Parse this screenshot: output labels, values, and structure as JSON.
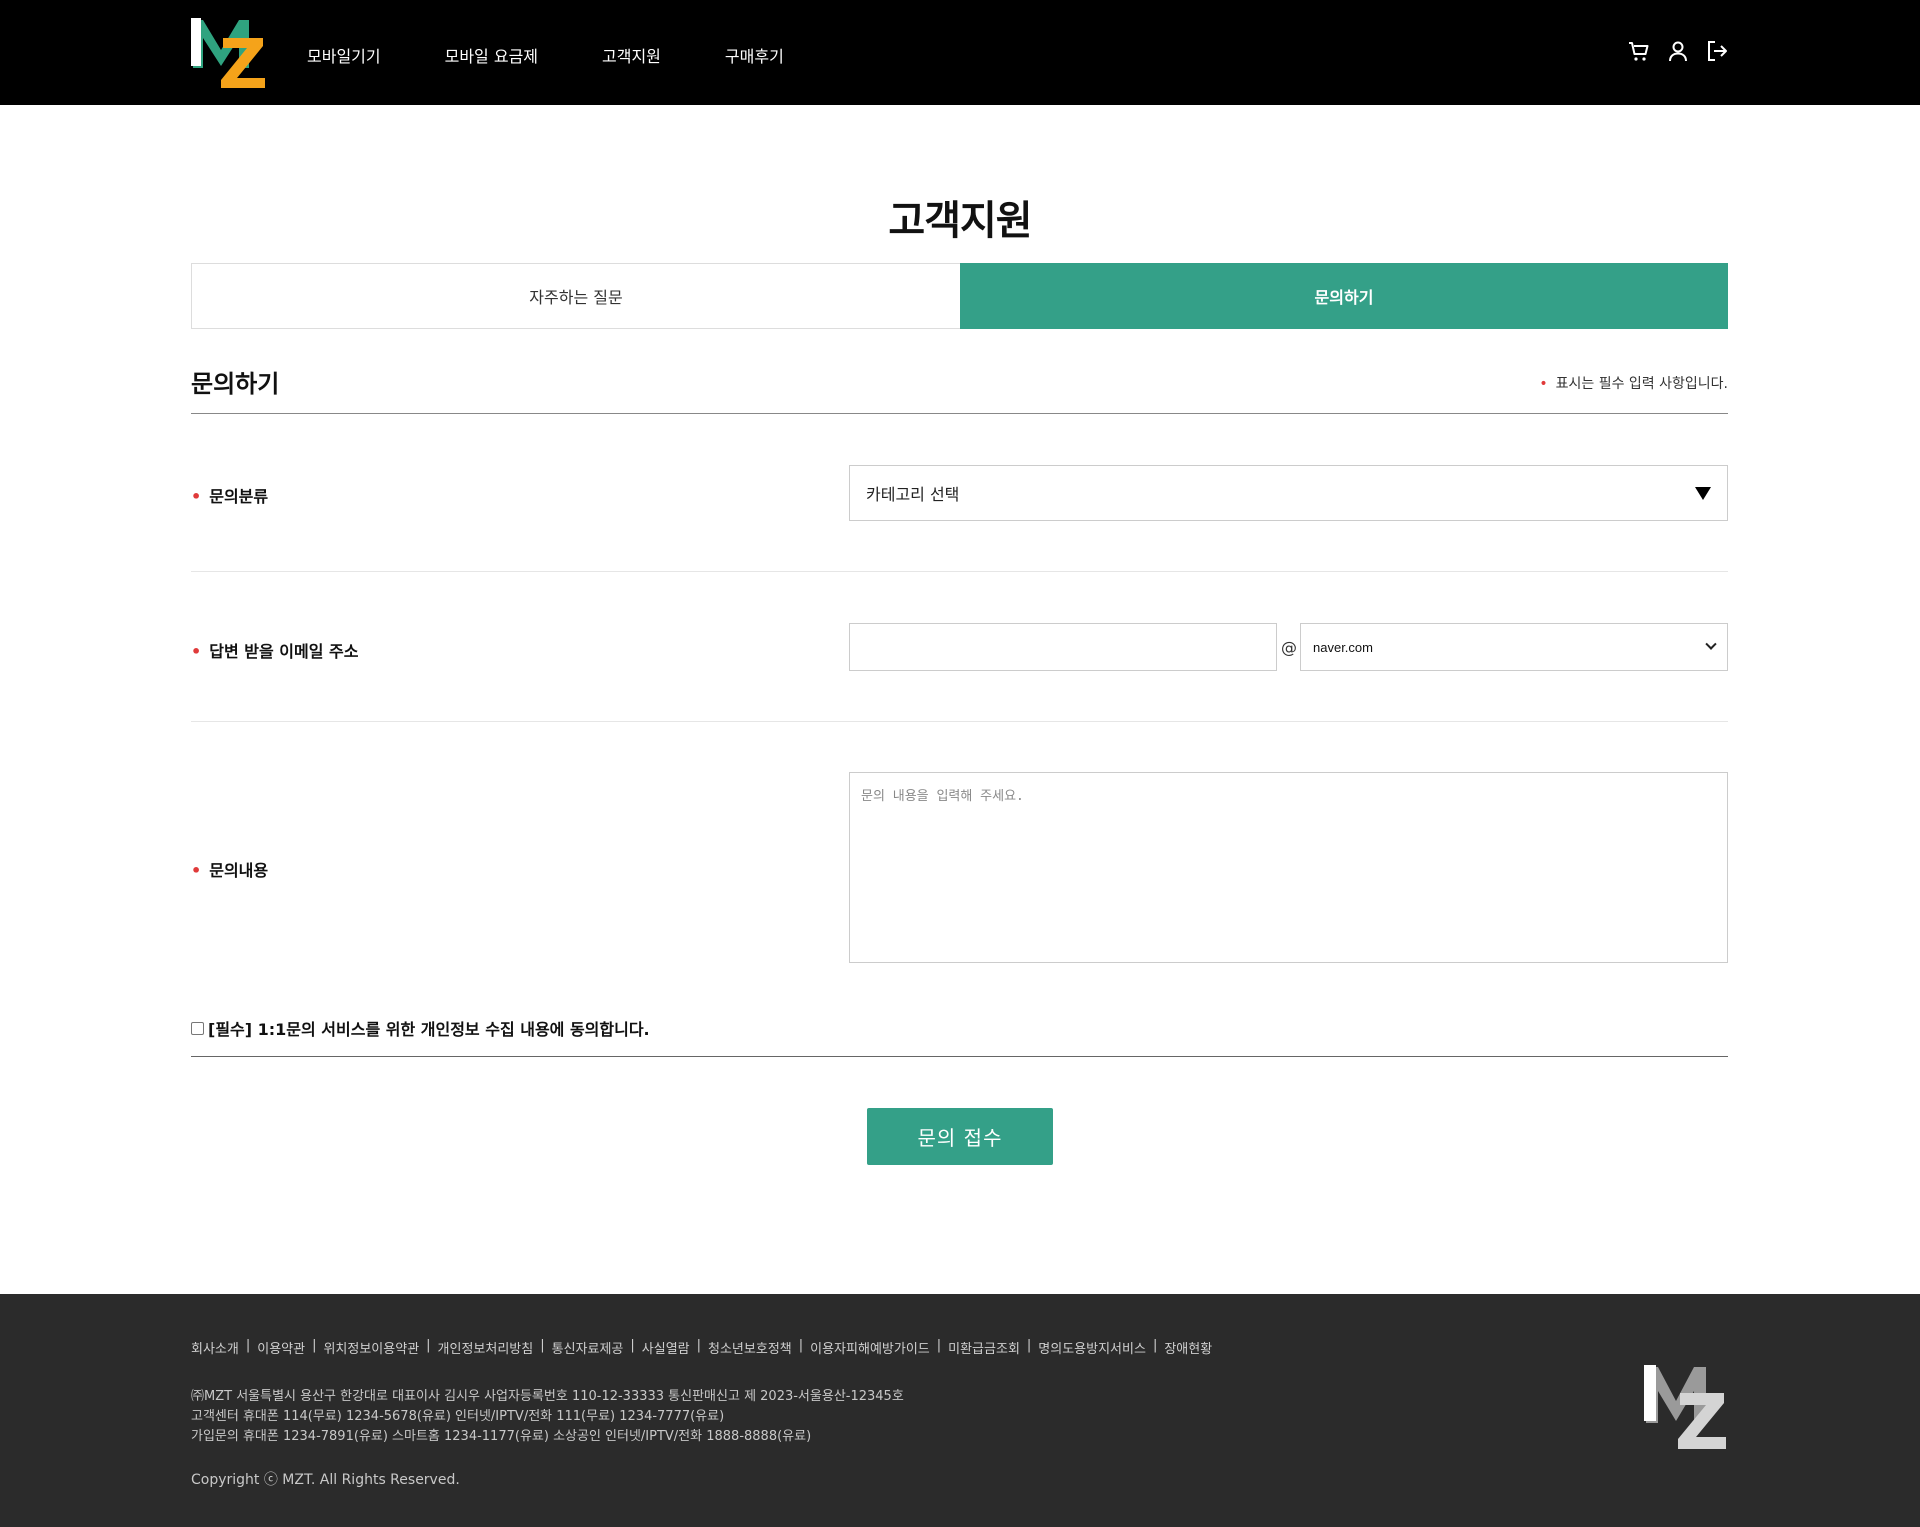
{
  "header": {
    "logo_text": "MZ",
    "nav": [
      "모바일기기",
      "모바일 요금제",
      "고객지원",
      "구매후기"
    ],
    "icons": [
      "cart-icon",
      "user-icon",
      "logout-icon"
    ]
  },
  "page": {
    "title": "고객지원",
    "tabs": [
      {
        "label": "자주하는 질문",
        "active": false
      },
      {
        "label": "문의하기",
        "active": true
      }
    ],
    "section_title": "문의하기",
    "required_note": "표시는 필수 입력 사항입니다."
  },
  "form": {
    "category": {
      "label": "문의분류",
      "selected": "카테고리 선택"
    },
    "email": {
      "label": "답변 받을 이메일 주소",
      "value": "",
      "at": "@",
      "domain_selected": "naver.com"
    },
    "content": {
      "label": "문의내용",
      "placeholder": "문의 내용을 입력해 주세요."
    },
    "consent_label": "[필수] 1:1문의 서비스를 위한 개인정보 수집 내용에 동의합니다.",
    "consent_checked": false,
    "submit_label": "문의 접수"
  },
  "footer": {
    "links": [
      "회사소개",
      "이용약관",
      "위치정보이용약관",
      "개인정보처리방침",
      "통신자료제공",
      "사실열람",
      "청소년보호정책",
      "이용자피해예방가이드",
      "미환급금조회",
      "명의도용방지서비스",
      "장애현황"
    ],
    "info_lines": [
      "㈜MZT 서울특별시 용산구 한강대로 대표이사 김시우 사업자등록번호 110-12-33333 통신판매신고 제 2023-서울용산-12345호",
      "고객센터 휴대폰 114(무료) 1234-5678(유료) 인터넷/IPTV/전화 111(무료) 1234-7777(유료)",
      "가입문의 휴대폰 1234-7891(유료) 스마트홈 1234-1177(유료) 소상공인 인터넷/IPTV/전화 1888-8888(유료)"
    ],
    "copyright": "Copyright ⓒ MZT. All Rights Reserved."
  },
  "colors": {
    "accent": "#34a088",
    "header_bg": "#000000",
    "footer_bg": "#2b2b2b",
    "required_dot": "#e03a3a",
    "logo_green": "#2fa37f",
    "logo_orange": "#f5a31a"
  }
}
